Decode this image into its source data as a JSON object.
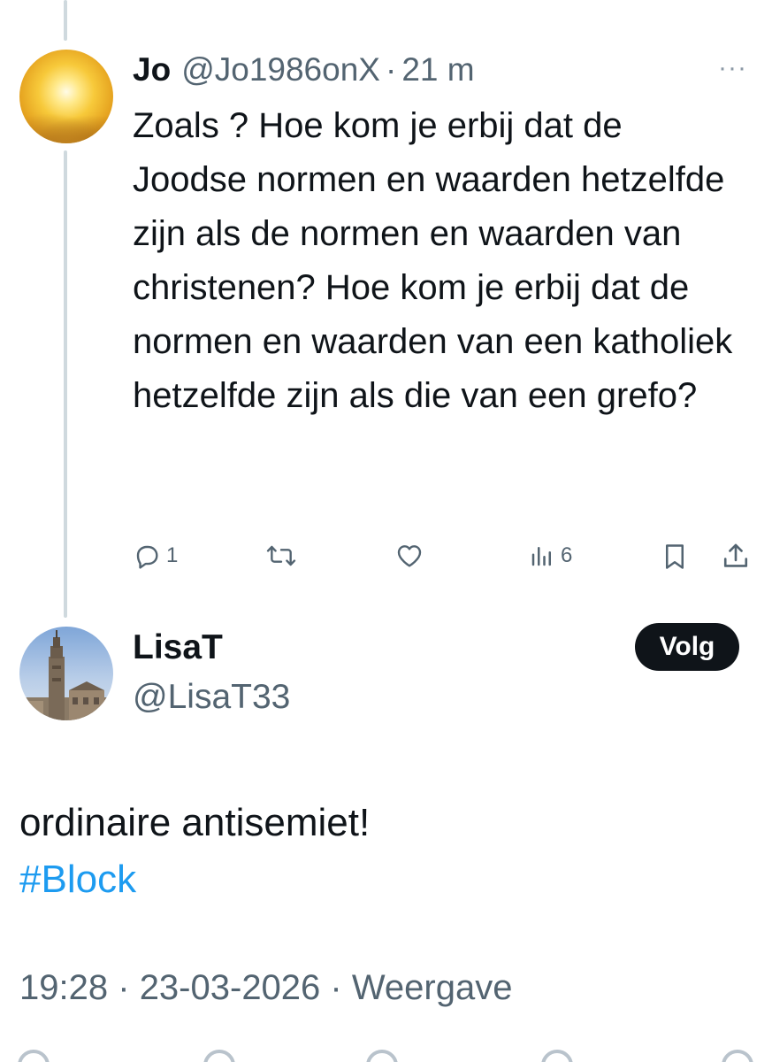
{
  "parent_tweet": {
    "name": "Jo",
    "handle": "@Jo1986onX",
    "separator": "·",
    "time": "21 m",
    "more": "···",
    "body": "Zoals ? Hoe kom je erbij dat de Joodse normen en waarden hetzelfde zijn als de normen en waarden van christenen? Hoe kom je erbij dat de normen en waarden van een katholiek hetzelfde zijn als die van een grefo?",
    "actions": {
      "reply_count": "1",
      "views_count": "6"
    }
  },
  "main_tweet": {
    "name": "LisaT",
    "handle": "@LisaT33",
    "follow_label": "Volg",
    "text": "ordinaire antisemiet!",
    "hashtag": "#Block",
    "time": "19:28",
    "date": "23-03-2026",
    "views_label": "Weergave",
    "separator": "·"
  },
  "colors": {
    "link": "#1d9bf0",
    "secondary_text": "#536471",
    "primary_text": "#0f1419",
    "button_bg": "#0f1419",
    "thread_line": "#cfd9de"
  },
  "icons": [
    "reply-icon",
    "retweet-icon",
    "like-icon",
    "views-icon",
    "bookmark-icon",
    "share-icon",
    "more-icon"
  ]
}
